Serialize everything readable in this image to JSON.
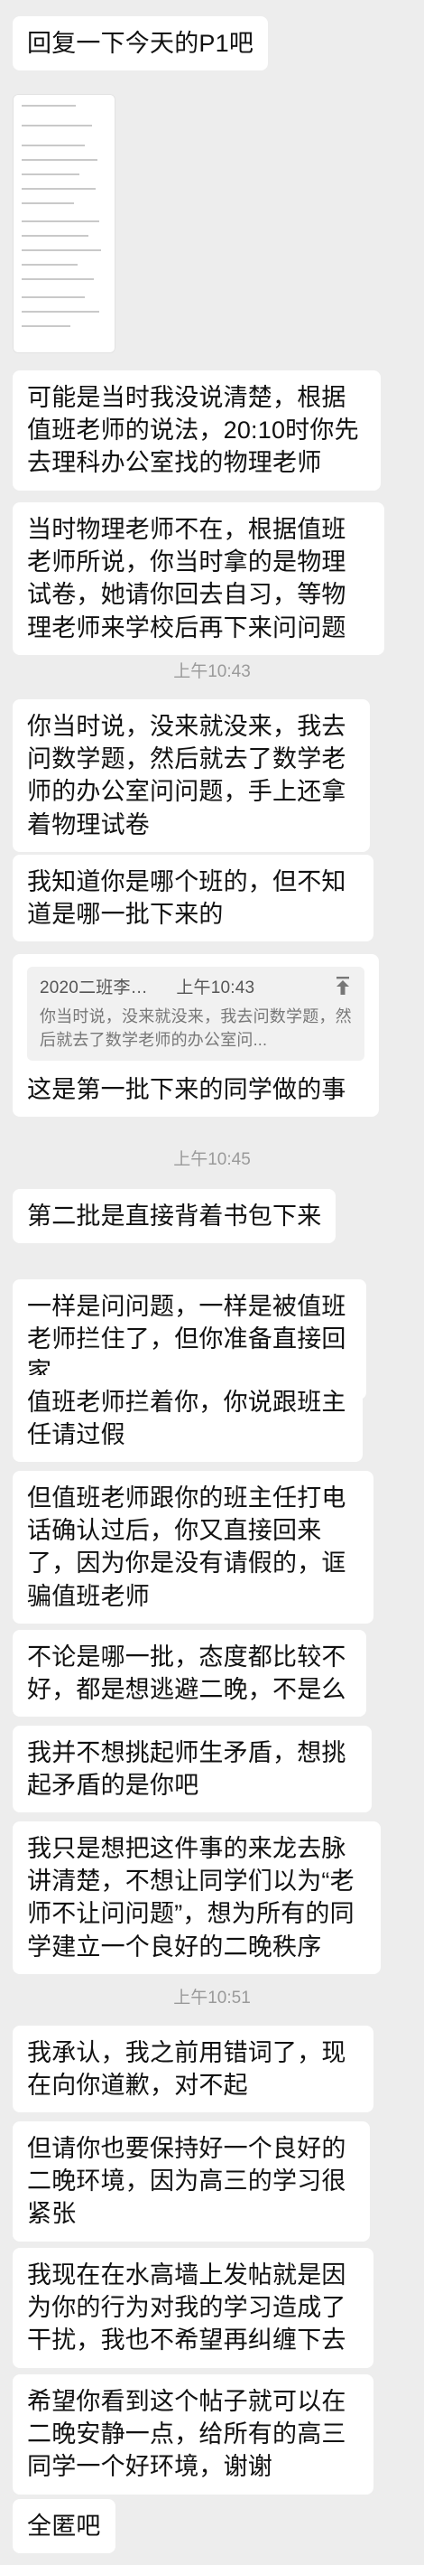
{
  "messages": {
    "m1": "回复一下今天的P1吧",
    "m2": "可能是当时我没说清楚，根据值班老师的说法，20:10时你先去理科办公室找的物理老师",
    "m3": "当时物理老师不在，根据值班老师所说，你当时拿的是物理试卷，她请你回去自习，等物理老师来学校后再下来问问题",
    "m4": "你当时说，没来就没来，我去问数学题，然后就去了数学老师的办公室问问题，手上还拿着物理试卷",
    "m5": "我知道你是哪个班的，但不知道是哪一批下来的",
    "m6": "这是第一批下来的同学做的事",
    "m7": "第二批是直接背着书包下来",
    "m8": "一样是问问题，一样是被值班老师拦住了，但你准备直接回家",
    "m9": "值班老师拦着你，你说跟班主任请过假",
    "m10": "但值班老师跟你的班主任打电话确认过后，你又直接回来了，因为你是没有请假的，诓骗值班老师",
    "m11": "不论是哪一批，态度都比较不好，都是想逃避二晚，不是么",
    "m12": "我并不想挑起师生矛盾，想挑起矛盾的是你吧",
    "m13": "我只是想把这件事的来龙去脉讲清楚，不想让同学们以为“老师不让问问题”，想为所有的同学建立一个良好的二晚秩序",
    "m14": "我承认，我之前用错词了，现在向你道歉，对不起",
    "m15": "但请你也要保持好一个良好的二晚环境，因为高三的学习很紧张",
    "m16": "我现在在水高墙上发帖就是因为你的行为对我的学习造成了干扰，我也不希望再纠缠下去",
    "m17": "希望你看到这个帖子就可以在二晚安静一点，给所有的高三同学一个好环境，谢谢",
    "m18": "全匿吧"
  },
  "timestamps": {
    "t1": "上午10:43",
    "t2": "上午10:45",
    "t3": "上午10:51"
  },
  "quote": {
    "sender": "2020二班李…",
    "time": "上午10:43",
    "text": "你当时说，没来就没来，我去问数学题，然后就去了数学老师的办公室问..."
  }
}
